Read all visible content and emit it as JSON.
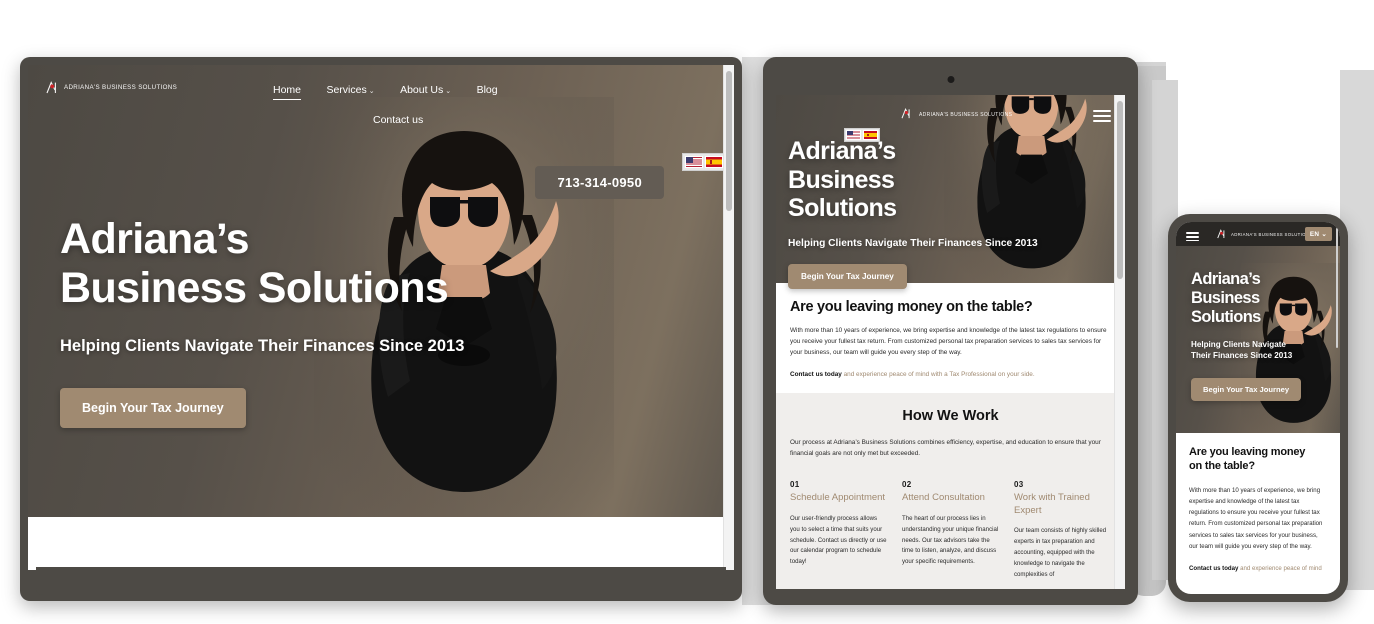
{
  "brand": {
    "name": "ADRIANA'S BUSINESS SOLUTIONS",
    "logo_icon": "adriana-logo-mark",
    "accent_color": "#a08a71",
    "logo_dot_color": "#d81f26"
  },
  "desktop": {
    "nav": {
      "items": [
        {
          "label": "Home",
          "active": true,
          "has_caret": false
        },
        {
          "label": "Services",
          "active": false,
          "has_caret": true
        },
        {
          "label": "About Us",
          "active": false,
          "has_caret": true
        },
        {
          "label": "Blog",
          "active": false,
          "has_caret": false
        }
      ],
      "second_row": {
        "label": "Contact us"
      },
      "phone": "713-314-0950",
      "caret_glyph": "⌄"
    },
    "language": {
      "options": [
        {
          "code": "en",
          "icon": "flag-us-icon"
        },
        {
          "code": "es",
          "icon": "flag-es-icon"
        }
      ]
    },
    "hero": {
      "title_line1": "Adriana’s",
      "title_line2": "Business Solutions",
      "subtitle": "Helping Clients Navigate Their Finances Since 2013",
      "cta": "Begin Your Tax Journey"
    }
  },
  "tablet": {
    "nav": {
      "menu_icon": "hamburger-menu-icon"
    },
    "language": {
      "options": [
        {
          "code": "en",
          "icon": "flag-us-icon"
        },
        {
          "code": "es",
          "icon": "flag-es-icon"
        }
      ]
    },
    "hero": {
      "title_line1": "Adriana’s",
      "title_line2": "Business",
      "title_line3": "Solutions",
      "subtitle": "Helping Clients Navigate Their Finances Since 2013",
      "cta": "Begin Your Tax Journey"
    },
    "value_section": {
      "heading": "Are you leaving money on the table?",
      "body": "With more than 10 years of experience, we bring expertise and knowledge of the latest tax regulations to ensure you receive your fullest tax return. From customized personal tax preparation services to sales tax services for your business, our team will guide you every step of the way.",
      "cta_bold": "Contact us today",
      "cta_rest": " and experience peace of mind with a Tax Professional on your side."
    },
    "how_we_work": {
      "heading": "How We Work",
      "intro": "Our process at Adriana’s Business Solutions combines efficiency, expertise, and education to ensure that your financial goals are not only met but exceeded.",
      "steps": [
        {
          "number": "01",
          "title": "Schedule Appointment",
          "body": "Our user-friendly process allows you to select a time that suits your schedule. Contact us directly or use our calendar program to schedule today!"
        },
        {
          "number": "02",
          "title": "Attend Consultation",
          "body": "The heart of our process lies in understanding your unique financial needs. Our tax advisors take the time to listen, analyze, and discuss your specific requirements."
        },
        {
          "number": "03",
          "title": "Work with Trained Expert",
          "body": "Our team consists of highly skilled experts in tax preparation and accounting, equipped with the knowledge to navigate the complexities of"
        }
      ]
    }
  },
  "mobile": {
    "nav": {
      "menu_icon": "hamburger-menu-icon",
      "language_label": "EN",
      "language_caret": "⌄"
    },
    "hero": {
      "title_line1": "Adriana’s",
      "title_line2": "Business",
      "title_line3": "Solutions",
      "subtitle_line1": "Helping Clients Navigate",
      "subtitle_line2": "Their Finances Since 2013",
      "cta": "Begin Your Tax Journey"
    },
    "value_section": {
      "heading_line1": "Are you leaving money",
      "heading_line2": "on the table?",
      "body": "With more than 10 years of experience, we bring expertise and knowledge of the latest tax regulations to ensure you receive your fullest tax return. From customized personal tax preparation services to sales tax services for your business, our team will guide you every step of the way.",
      "cta_bold": "Contact us today",
      "cta_rest": " and experience peace of mind"
    }
  }
}
